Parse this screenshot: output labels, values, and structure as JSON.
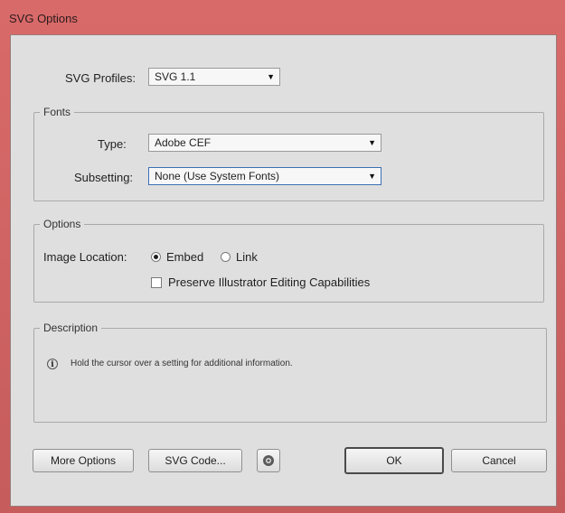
{
  "window": {
    "title": "SVG Options"
  },
  "profiles": {
    "label": "SVG Profiles:",
    "value": "SVG 1.1"
  },
  "fonts": {
    "group_label": "Fonts",
    "type_label": "Type:",
    "type_value": "Adobe CEF",
    "subsetting_label": "Subsetting:",
    "subsetting_value": "None (Use System Fonts)"
  },
  "options": {
    "group_label": "Options",
    "image_location_label": "Image Location:",
    "embed_label": "Embed",
    "link_label": "Link",
    "selected": "Embed",
    "preserve_label": "Preserve Illustrator Editing Capabilities",
    "preserve_checked": false
  },
  "description": {
    "group_label": "Description",
    "text": "Hold the cursor over a setting for additional information."
  },
  "buttons": {
    "more_options": "More Options",
    "svg_code": "SVG Code...",
    "ok": "OK",
    "cancel": "Cancel"
  },
  "icons": {
    "dropdown_arrow": "chevron-down-icon",
    "info": "info-icon",
    "web": "globe-icon"
  }
}
